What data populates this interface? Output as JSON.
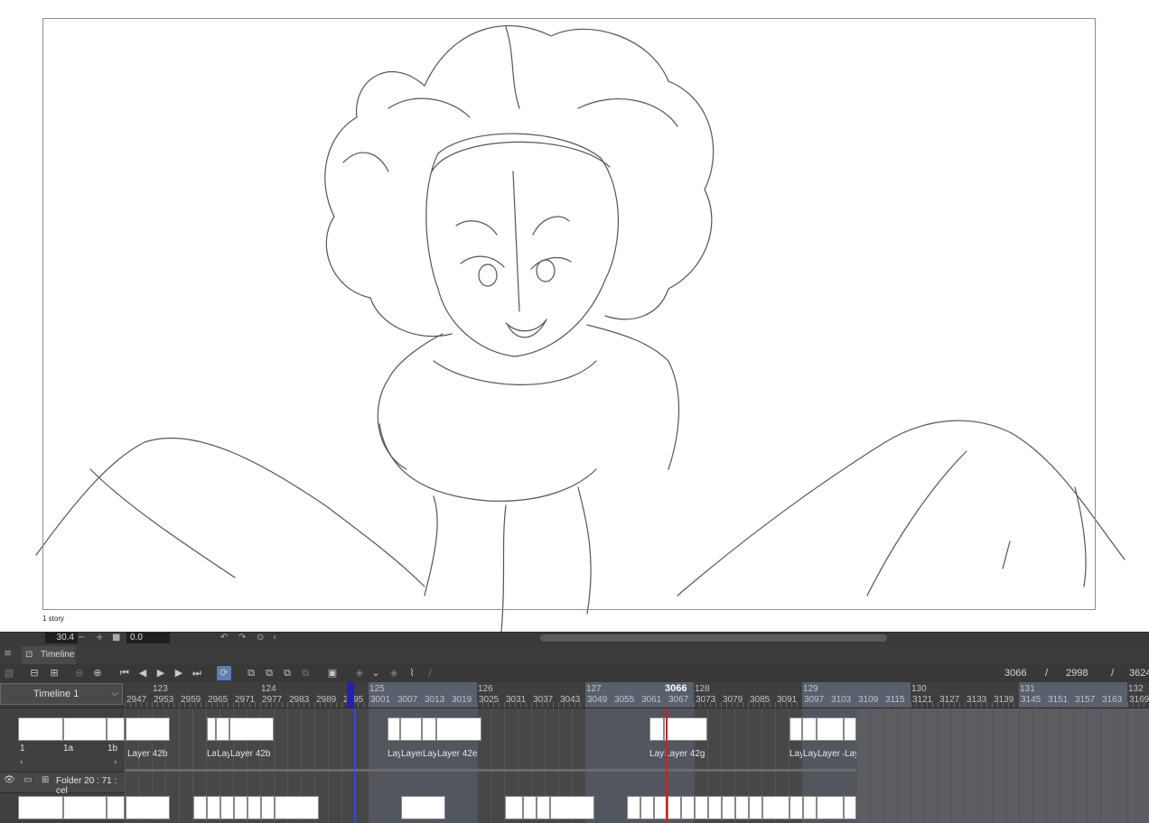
{
  "canvas": {
    "frame_label": "1 story"
  },
  "statusbar": {
    "zoom": "30.4",
    "minus": "−",
    "plus": "+",
    "angle": "0.0"
  },
  "panel": {
    "title": "Timeline"
  },
  "toolbar": {
    "current_frame": "3066",
    "separator1": "/",
    "start_frame": "2998",
    "separator2": "/",
    "end_frame": "3624"
  },
  "timeline_select": {
    "value": "Timeline 1"
  },
  "ruler": {
    "playhead_frame": "3066",
    "seconds": [
      "123",
      "124",
      "125",
      "126",
      "127",
      "128",
      "129",
      "130",
      "131",
      "132"
    ],
    "frames": [
      "2947",
      "2953",
      "2959",
      "2965",
      "2971",
      "2977",
      "2983",
      "2989",
      "2995",
      "3001",
      "3007",
      "3013",
      "3019",
      "3025",
      "3031",
      "3037",
      "3043",
      "3049",
      "3055",
      "3061",
      "3067",
      "3073",
      "3079",
      "3085",
      "3091",
      "3097",
      "3103",
      "3109",
      "3115",
      "3121",
      "3127",
      "3133",
      "3139",
      "3145",
      "3151",
      "3157",
      "3163",
      "3169"
    ]
  },
  "tracks": {
    "left_cels": [
      "1",
      "1a",
      "1b"
    ],
    "folder": "Folder 20 : 71 : cel",
    "cel_labels": [
      "Layer 42b",
      "La",
      "Lay",
      "Layer 42b",
      "Lay",
      "Layer",
      "Lay",
      "Layer 42e",
      "Lay",
      "Layer 42g",
      "Lay",
      "Lay",
      "Layer 4",
      "Lay"
    ]
  }
}
